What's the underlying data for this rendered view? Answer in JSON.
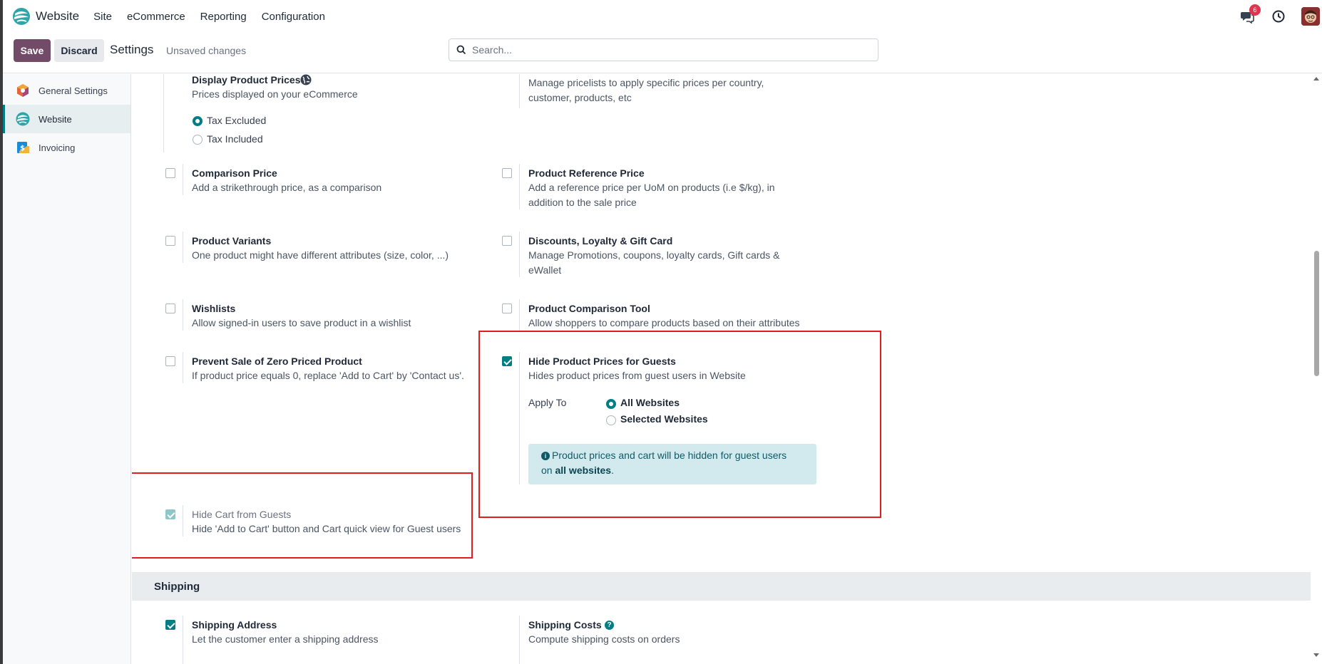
{
  "navbar": {
    "app_name": "Website",
    "menu": [
      "Site",
      "eCommerce",
      "Reporting",
      "Configuration"
    ],
    "chat_badge": "6",
    "icons": [
      "website-logo-icon",
      "chat-icon",
      "clock-icon",
      "user-avatar"
    ]
  },
  "control_panel": {
    "save_label": "Save",
    "discard_label": "Discard",
    "title": "Settings",
    "status": "Unsaved changes",
    "search_placeholder": "Search..."
  },
  "sidebar": {
    "items": [
      {
        "label": "General Settings",
        "icon": "general-settings-icon",
        "active": false
      },
      {
        "label": "Website",
        "icon": "website-icon",
        "active": true
      },
      {
        "label": "Invoicing",
        "icon": "invoicing-icon",
        "active": false
      }
    ]
  },
  "settings": {
    "display_prices": {
      "title": "Display Product Prices",
      "icon": "globe-icon",
      "desc": "Prices displayed on your eCommerce",
      "options": [
        "Tax Excluded",
        "Tax Included"
      ],
      "selected": "Tax Excluded"
    },
    "pricelists": {
      "desc_line1": "Manage pricelists to apply specific prices per country,",
      "desc_line2": "customer, products, etc"
    },
    "comparison_price": {
      "title": "Comparison Price",
      "desc": "Add a strikethrough price, as a comparison",
      "checked": false
    },
    "reference_price": {
      "title": "Product Reference Price",
      "desc_line1": "Add a reference price per UoM on products (i.e $/kg), in",
      "desc_line2": "addition to the sale price",
      "checked": false
    },
    "variants": {
      "title": "Product Variants",
      "desc": "One product might have different attributes (size, color, ...)",
      "checked": false
    },
    "discounts": {
      "title": "Discounts, Loyalty & Gift Card",
      "desc_line1": "Manage Promotions, coupons, loyalty cards, Gift cards &",
      "desc_line2": "eWallet",
      "checked": false
    },
    "wishlists": {
      "title": "Wishlists",
      "desc": "Allow signed-in users to save product in a wishlist",
      "checked": false
    },
    "comparison_tool": {
      "title": "Product Comparison Tool",
      "desc": "Allow shoppers to compare products based on their attributes",
      "checked": false
    },
    "zero_price": {
      "title": "Prevent Sale of Zero Priced Product",
      "desc": "If product price equals 0, replace 'Add to Cart' by 'Contact us'.",
      "checked": false
    },
    "hide_prices": {
      "title": "Hide Product Prices for Guests",
      "desc": "Hides product prices from guest users in Website",
      "checked": true,
      "apply_to_label": "Apply To",
      "options": [
        "All Websites",
        "Selected Websites"
      ],
      "selected": "All Websites",
      "alert_icon": "info-icon",
      "alert_line1": "Product prices and cart will be hidden for guest users",
      "alert_line2_prefix": "on ",
      "alert_line2_bold": "all websites",
      "alert_line2_suffix": "."
    },
    "hide_cart": {
      "title": "Hide Cart from Guests",
      "desc": "Hide 'Add to Cart' button and Cart quick view for Guest users",
      "checked": true,
      "disabled": true
    }
  },
  "shipping": {
    "section_title": "Shipping",
    "address": {
      "title": "Shipping Address",
      "desc": "Let the customer enter a shipping address",
      "checked": true
    },
    "costs": {
      "title": "Shipping Costs",
      "icon": "help-icon",
      "desc": "Compute shipping costs on orders"
    }
  }
}
